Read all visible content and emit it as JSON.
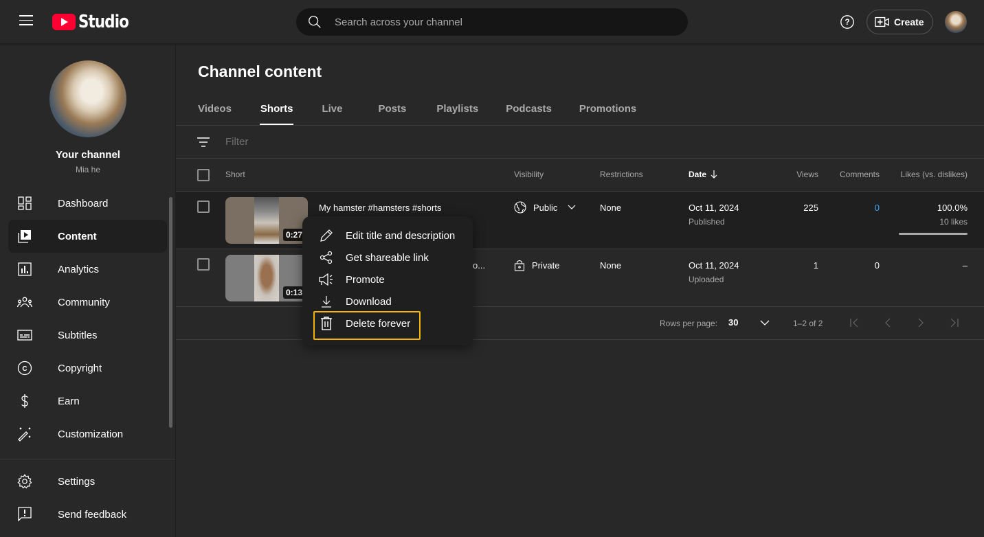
{
  "app": {
    "logo_text": "Studio"
  },
  "header": {
    "search_placeholder": "Search across your channel",
    "create_label": "Create"
  },
  "sidebar": {
    "channel_title": "Your channel",
    "channel_name": "Mia he",
    "items": [
      {
        "label": "Dashboard",
        "icon": "dashboard-icon"
      },
      {
        "label": "Content",
        "icon": "content-icon",
        "active": true
      },
      {
        "label": "Analytics",
        "icon": "analytics-icon"
      },
      {
        "label": "Community",
        "icon": "community-icon"
      },
      {
        "label": "Subtitles",
        "icon": "subtitles-icon"
      },
      {
        "label": "Copyright",
        "icon": "copyright-icon"
      },
      {
        "label": "Earn",
        "icon": "dollar-icon"
      },
      {
        "label": "Customization",
        "icon": "magic-wand-icon"
      }
    ],
    "bottom_items": [
      {
        "label": "Settings",
        "icon": "gear-icon"
      },
      {
        "label": "Send feedback",
        "icon": "feedback-icon"
      }
    ]
  },
  "main": {
    "title": "Channel content",
    "tabs": [
      {
        "label": "Videos"
      },
      {
        "label": "Shorts",
        "active": true
      },
      {
        "label": "Live"
      },
      {
        "label": "Posts"
      },
      {
        "label": "Playlists"
      },
      {
        "label": "Podcasts"
      },
      {
        "label": "Promotions"
      }
    ],
    "filter_placeholder": "Filter",
    "columns": {
      "short": "Short",
      "visibility": "Visibility",
      "restrictions": "Restrictions",
      "date": "Date",
      "views": "Views",
      "comments": "Comments",
      "likes": "Likes (vs. dislikes)"
    },
    "rows": [
      {
        "title": "My hamster #hamsters #shorts",
        "duration": "0:27",
        "visibility": "Public",
        "restrictions": "None",
        "date": "Oct 11, 2024",
        "date_status": "Published",
        "views": "225",
        "comments": "0",
        "likes_pct": "100.0%",
        "likes_count": "10 likes",
        "like_ratio": 1.0
      },
      {
        "title_truncated_tail": "o...",
        "duration": "0:13",
        "visibility": "Private",
        "restrictions": "None",
        "date": "Oct 11, 2024",
        "date_status": "Uploaded",
        "views": "1",
        "comments": "0",
        "likes_pct": "–"
      }
    ],
    "pagination": {
      "rows_per_page_label": "Rows per page:",
      "rows_per_page": "30",
      "range": "1–2 of 2"
    }
  },
  "context_menu": {
    "items": [
      {
        "label": "Edit title and description",
        "icon": "pencil-icon"
      },
      {
        "label": "Get shareable link",
        "icon": "share-icon"
      },
      {
        "label": "Promote",
        "icon": "megaphone-icon"
      },
      {
        "label": "Download",
        "icon": "download-icon"
      },
      {
        "label": "Delete forever",
        "icon": "trash-icon",
        "highlighted": true
      }
    ],
    "highlight_color": "#f5b400"
  },
  "colors": {
    "accent_blue": "#3ea6ff",
    "brand_red": "#ff0033"
  }
}
